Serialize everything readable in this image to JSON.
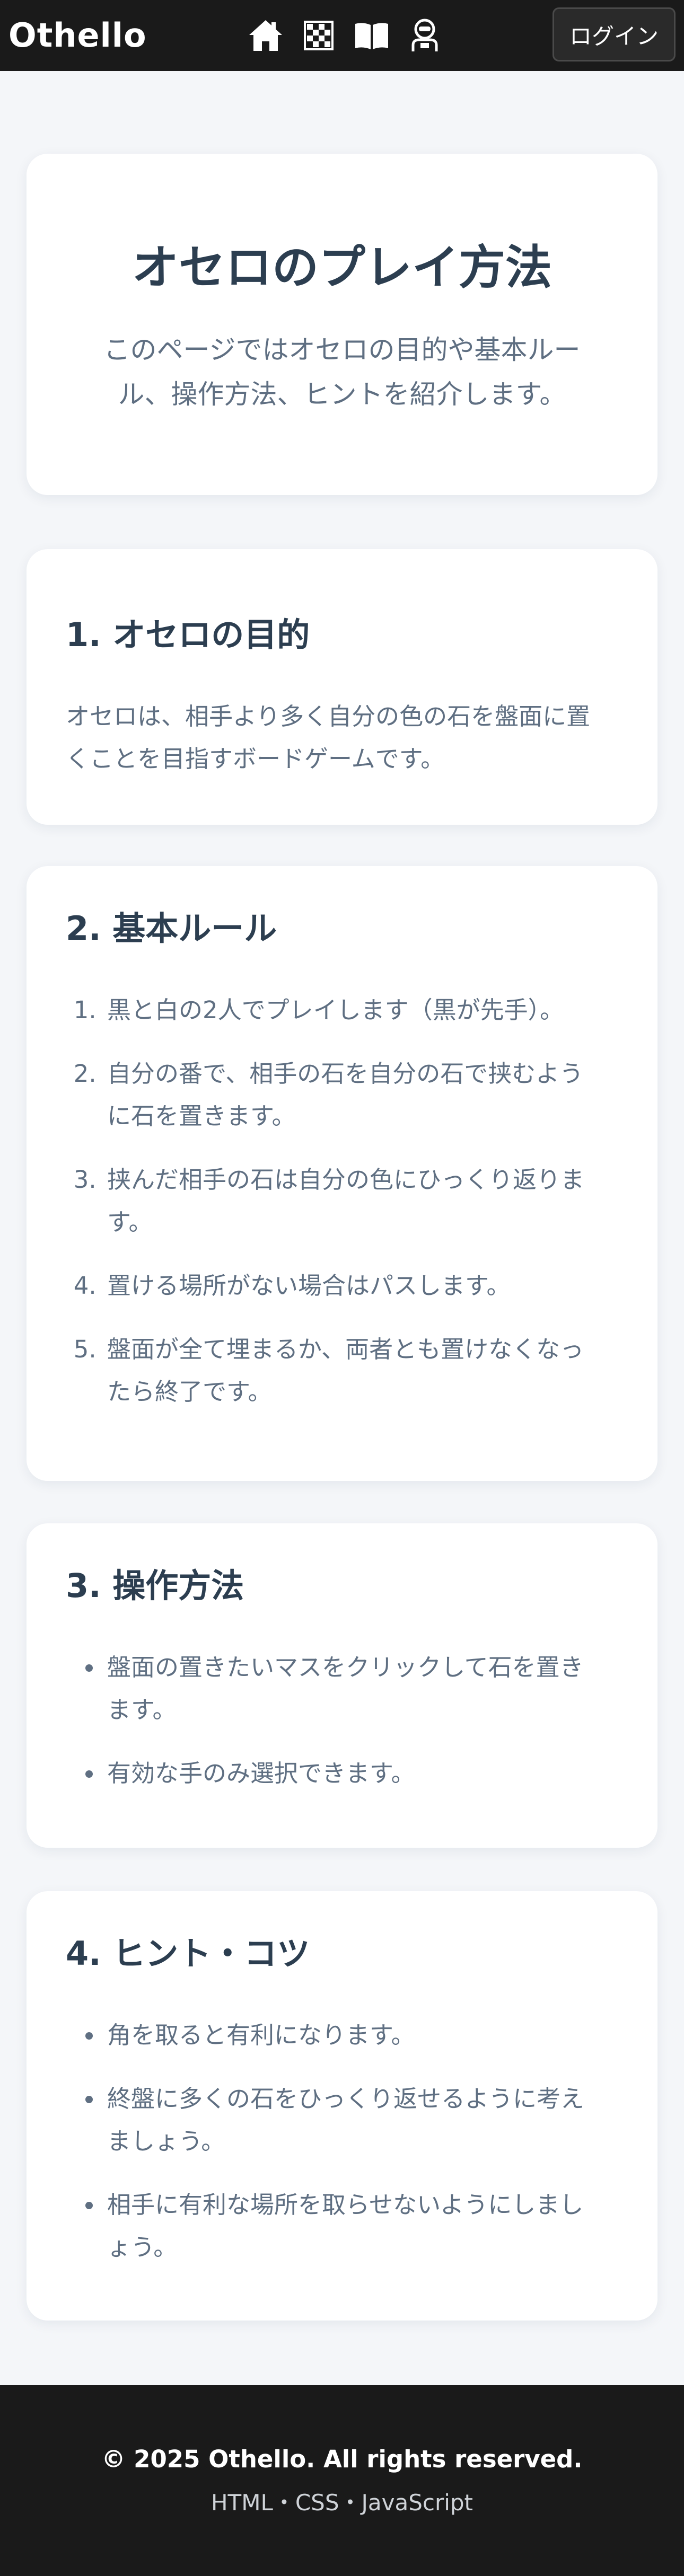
{
  "header": {
    "brand": "Othello",
    "icons": [
      "home-icon",
      "checkerboard-icon",
      "book-icon",
      "robot-icon"
    ],
    "login_label": "ログイン"
  },
  "hero": {
    "title": "オセロのプレイ方法",
    "description": "このページではオセロの目的や基本ルール、操作方法、ヒントを紹介します。"
  },
  "sections": [
    {
      "title": "1. オセロの目的",
      "text": "オセロは、相手より多く自分の色の石を盤面に置くことを目指すボードゲームです。"
    },
    {
      "title": "2. 基本ルール",
      "items": [
        "黒と白の2人でプレイします（黒が先手）。",
        "自分の番で、相手の石を自分の石で挟むように石を置きます。",
        "挟んだ相手の石は自分の色にひっくり返ります。",
        "置ける場所がない場合はパスします。",
        "盤面が全て埋まるか、両者とも置けなくなったら終了です。"
      ]
    },
    {
      "title": "3. 操作方法",
      "items": [
        "盤面の置きたいマスをクリックして石を置きます。",
        "有効な手のみ選択できます。"
      ]
    },
    {
      "title": "4. ヒント・コツ",
      "items": [
        "角を取ると有利になります。",
        "終盤に多くの石をひっくり返せるように考えましょう。",
        "相手に有利な場所を取らせないようにしましょう。"
      ]
    }
  ],
  "footer": {
    "copyright": "© 2025 Othello. All rights reserved.",
    "tech": "HTML・CSS・JavaScript"
  },
  "colors": {
    "header_bg": "#1a1a1a",
    "page_bg": "#f4f6f9",
    "card_bg": "#ffffff",
    "title_text": "#2c3e50",
    "body_text": "#5f6f82"
  }
}
